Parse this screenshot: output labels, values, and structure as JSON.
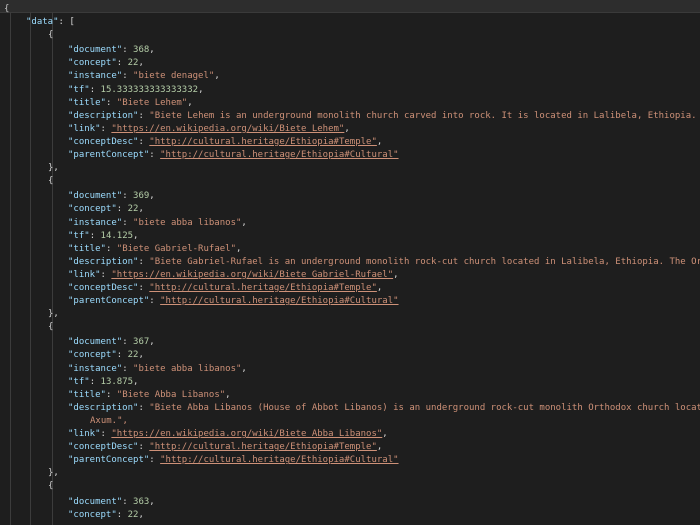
{
  "editor": {
    "open_brace": "{",
    "data_key": "\"data\"",
    "open_bracket": ": [",
    "records": [
      {
        "document": "368",
        "concept": "22",
        "instance": "\"biete denagel\"",
        "tf": "15.333333333333332",
        "title": "\"Biete Lehem\"",
        "description": "\"Biete Lehem is an underground monolith church carved into rock. It is located in Lalibela, Ethiopia. I",
        "link": "\"https://en.wikipedia.org/wiki/Biete_Lehem\"",
        "conceptDesc": "\"http://cultural.heritage/Ethiopia#Temple\"",
        "parentConcept": "\"http://cultural.heritage/Ethiopia#Cultural\""
      },
      {
        "document": "369",
        "concept": "22",
        "instance": "\"biete abba libanos\"",
        "tf": "14.125",
        "title": "\"Biete Gabriel-Rufael\"",
        "description": "\"Biete Gabriel-Rufael is an underground monolith rock-cut church located in Lalibela, Ethiopia. The Ort",
        "link": "\"https://en.wikipedia.org/wiki/Biete_Gabriel-Rufael\"",
        "conceptDesc": "\"http://cultural.heritage/Ethiopia#Temple\"",
        "parentConcept": "\"http://cultural.heritage/Ethiopia#Cultural\""
      },
      {
        "document": "367",
        "concept": "22",
        "instance": "\"biete abba libanos\"",
        "tf": "13.875",
        "title": "\"Biete Abba Libanos\"",
        "description": "\"Biete Abba Libanos (House of Abbot Libanos) is an underground rock-cut monolith Orthodox church locate",
        "description_wrap": "Axum.\",",
        "link": "\"https://en.wikipedia.org/wiki/Biete_Abba_Libanos\"",
        "conceptDesc": "\"http://cultural.heritage/Ethiopia#Temple\"",
        "parentConcept": "\"http://cultural.heritage/Ethiopia#Cultural\""
      },
      {
        "document": "363",
        "concept": "22"
      }
    ]
  },
  "colors": {
    "background": "#1e1e1e",
    "key": "#9cdcfe",
    "string": "#ce9178",
    "number": "#b5cea8"
  }
}
